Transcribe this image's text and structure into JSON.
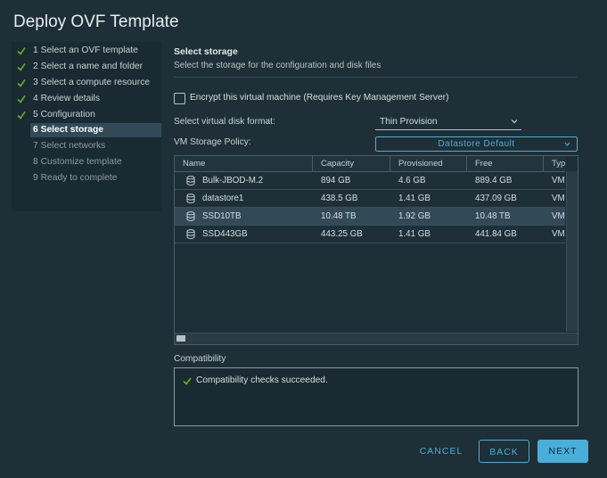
{
  "dialog": {
    "title": "Deploy OVF Template"
  },
  "nav": {
    "items": [
      {
        "label": "1 Select an OVF template",
        "state": "done"
      },
      {
        "label": "2 Select a name and folder",
        "state": "done"
      },
      {
        "label": "3 Select a compute resource",
        "state": "done"
      },
      {
        "label": "4 Review details",
        "state": "done"
      },
      {
        "label": "5 Configuration",
        "state": "done"
      },
      {
        "label": "6 Select storage",
        "state": "active"
      },
      {
        "label": "7 Select networks",
        "state": "pending"
      },
      {
        "label": "8 Customize template",
        "state": "pending"
      },
      {
        "label": "9 Ready to complete",
        "state": "pending"
      }
    ]
  },
  "main": {
    "heading": "Select storage",
    "subheading": "Select the storage for the configuration and disk files",
    "encrypt_label": "Encrypt this virtual machine (Requires Key Management Server)",
    "encrypt_checked": false,
    "disk_format_label": "Select virtual disk format:",
    "disk_format_value": "Thin Provision",
    "policy_label": "VM Storage Policy:",
    "policy_value": "Datastore Default"
  },
  "grid": {
    "columns": [
      "Name",
      "Capacity",
      "Provisioned",
      "Free",
      "Typ"
    ],
    "rows": [
      {
        "name": "Bulk-JBOD-M.2",
        "capacity": "894 GB",
        "provisioned": "4.6 GB",
        "free": "889.4 GB",
        "type": "VM"
      },
      {
        "name": "datastore1",
        "capacity": "438.5 GB",
        "provisioned": "1.41 GB",
        "free": "437.09 GB",
        "type": "VM"
      },
      {
        "name": "SSD10TB",
        "capacity": "10.48 TB",
        "provisioned": "1.92 GB",
        "free": "10.48 TB",
        "type": "VM",
        "selected": true
      },
      {
        "name": "SSD443GB",
        "capacity": "443.25 GB",
        "provisioned": "1.41 GB",
        "free": "441.84 GB",
        "type": "VM"
      }
    ]
  },
  "compatibility": {
    "label": "Compatibility",
    "message": "Compatibility checks succeeded."
  },
  "buttons": {
    "cancel": "CANCEL",
    "back": "BACK",
    "next": "NEXT"
  },
  "colors": {
    "accent": "#49afd9",
    "success": "#60b515",
    "background": "#1f2f38"
  },
  "icons": {
    "step_done": "check-icon",
    "datastore": "database-icon",
    "dropdown": "chevron-down-icon",
    "success": "check-icon"
  }
}
